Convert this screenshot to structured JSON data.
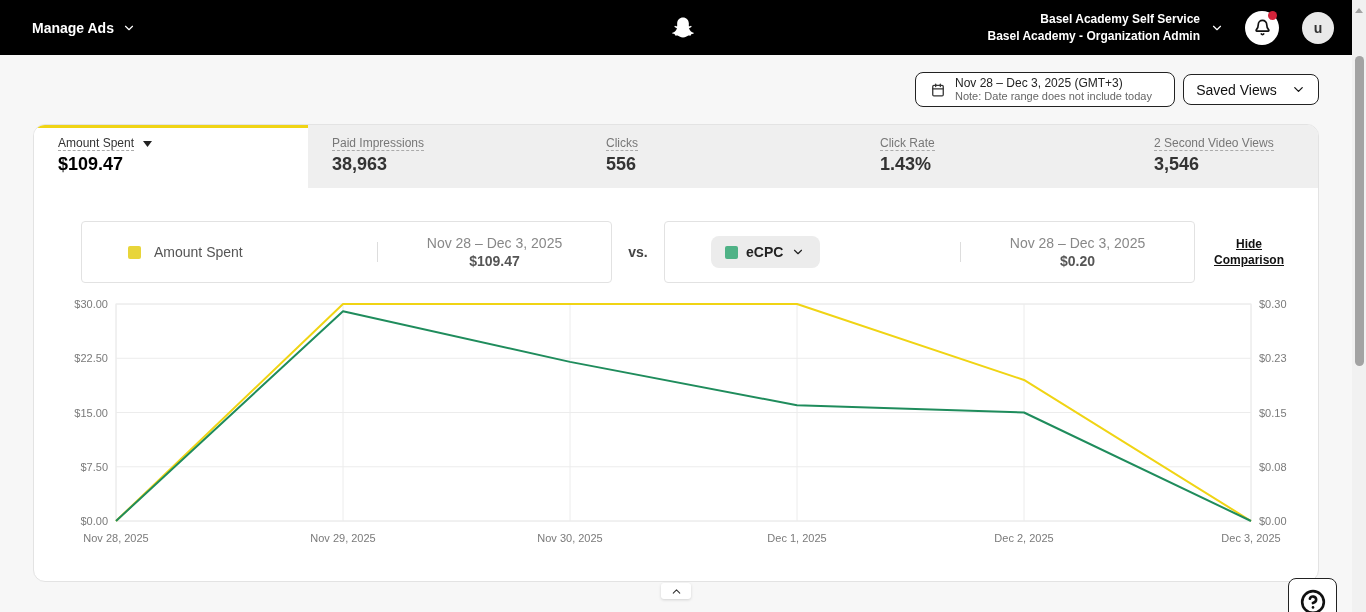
{
  "header": {
    "title": "Manage Ads",
    "account_name": "Basel Academy Self Service",
    "account_role": "Basel Academy - Organization Admin",
    "notifications": {
      "unread": true
    },
    "avatar_initial": "u"
  },
  "toolbar": {
    "date_range": {
      "label": "Nov 28 – Dec 3, 2025 (GMT+3)",
      "note": "Note: Date range does not include today"
    },
    "saved_views": "Saved Views"
  },
  "metric_tabs": [
    {
      "label": "Amount Spent",
      "value": "$109.47",
      "selected": true
    },
    {
      "label": "Paid Impressions",
      "value": "38,963",
      "selected": false
    },
    {
      "label": "Clicks",
      "value": "556",
      "selected": false
    },
    {
      "label": "Click Rate",
      "value": "1.43%",
      "selected": false
    },
    {
      "label": "2 Second Video Views",
      "value": "3,546",
      "selected": false
    }
  ],
  "comparison": {
    "primary": {
      "metric": "Amount Spent",
      "color": "#e8d53a",
      "date_range": "Nov 28 – Dec 3, 2025",
      "value": "$109.47"
    },
    "vs_label": "vs.",
    "secondary": {
      "metric": "eCPC",
      "color": "#4fb286",
      "date_range": "Nov 28 – Dec 3, 2025",
      "value": "$0.20"
    },
    "hide_link": "Hide Comparison"
  },
  "chart_data": {
    "type": "line",
    "grid": true,
    "categories": [
      "Nov 28, 2025",
      "Nov 29, 2025",
      "Nov 30, 2025",
      "Dec 1, 2025",
      "Dec 2, 2025",
      "Dec 3, 2025"
    ],
    "series": [
      {
        "color": "#f0d414",
        "axis": "y",
        "values": [
          0,
          30,
          30,
          30,
          19.5,
          0
        ]
      },
      {
        "color": "#1f8c5c",
        "axis": "y2",
        "values": [
          0,
          0.29,
          0.22,
          0.16,
          0.15,
          0
        ]
      }
    ],
    "ylim": [
      0,
      30
    ],
    "yticks": [
      {
        "value": 0,
        "label": "$0.00"
      },
      {
        "value": 7.5,
        "label": "$7.50"
      },
      {
        "value": 15,
        "label": "$15.00"
      },
      {
        "value": 22.5,
        "label": "$22.50"
      },
      {
        "value": 30,
        "label": "$30.00"
      }
    ],
    "y2lim": [
      0,
      0.3
    ],
    "y2ticks": [
      {
        "value": 0,
        "label": "$0.00"
      },
      {
        "value": 0.075,
        "label": "$0.08"
      },
      {
        "value": 0.15,
        "label": "$0.15"
      },
      {
        "value": 0.225,
        "label": "$0.23"
      },
      {
        "value": 0.3,
        "label": "$0.30"
      }
    ]
  }
}
